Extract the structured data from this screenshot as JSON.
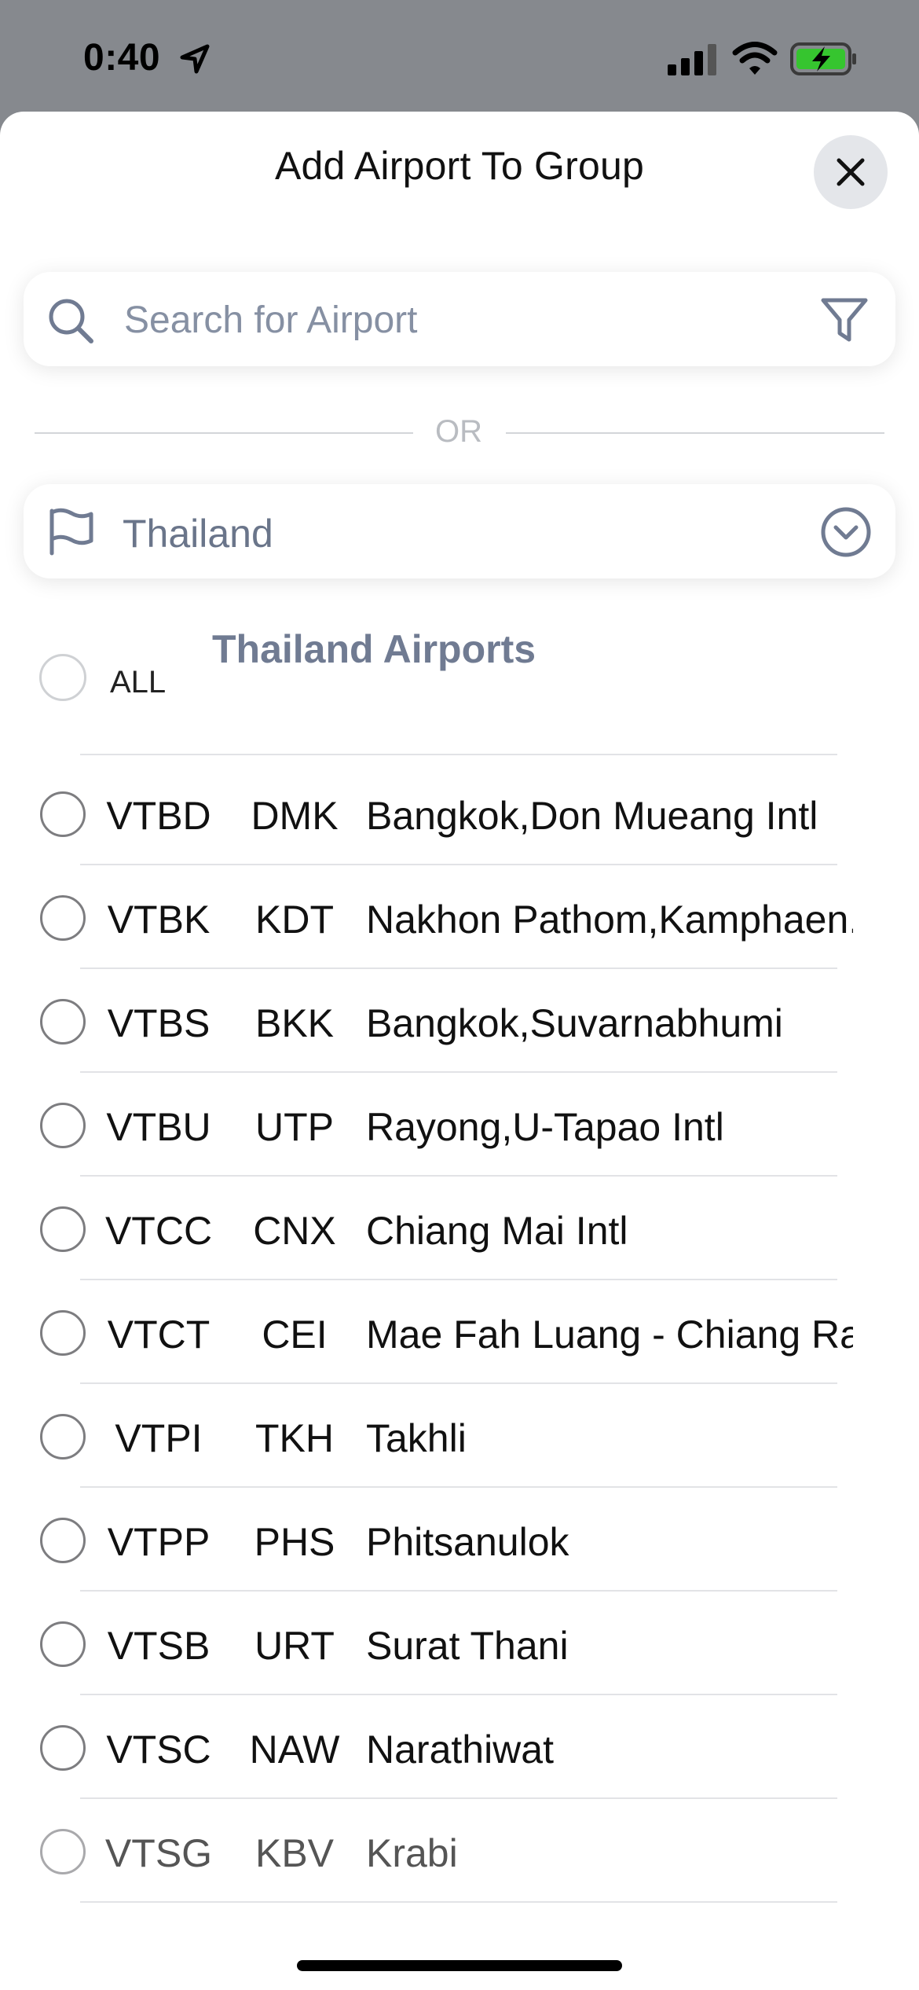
{
  "status_bar": {
    "time": "0:40"
  },
  "sheet": {
    "title": "Add Airport To Group"
  },
  "search": {
    "placeholder": "Search for Airport"
  },
  "separator_text": "OR",
  "country_select": {
    "value": "Thailand"
  },
  "select_all_label": "ALL",
  "section_title": "Thailand Airports",
  "airports": [
    {
      "icao": "VTBD",
      "iata": "DMK",
      "name": "Bangkok,Don Mueang Intl"
    },
    {
      "icao": "VTBK",
      "iata": "KDT",
      "name": "Nakhon Pathom,Kamphaen.."
    },
    {
      "icao": "VTBS",
      "iata": "BKK",
      "name": "Bangkok,Suvarnabhumi"
    },
    {
      "icao": "VTBU",
      "iata": "UTP",
      "name": "Rayong,U-Tapao Intl"
    },
    {
      "icao": "VTCC",
      "iata": "CNX",
      "name": "Chiang Mai Intl"
    },
    {
      "icao": "VTCT",
      "iata": "CEI",
      "name": "Mae Fah Luang - Chiang Ra.."
    },
    {
      "icao": "VTPI",
      "iata": "TKH",
      "name": "Takhli"
    },
    {
      "icao": "VTPP",
      "iata": "PHS",
      "name": "Phitsanulok"
    },
    {
      "icao": "VTSB",
      "iata": "URT",
      "name": "Surat Thani"
    },
    {
      "icao": "VTSC",
      "iata": "NAW",
      "name": "Narathiwat"
    },
    {
      "icao": "VTSG",
      "iata": "KBV",
      "name": "Krabi"
    }
  ],
  "icons": {
    "close": "close-icon",
    "search": "search-icon",
    "filter": "filter-icon",
    "flag": "flag-icon",
    "dropdown": "chevron-down-circle-icon"
  },
  "colors": {
    "accent_icon": "#707b92",
    "placeholder": "#8690a3",
    "battery_fill": "#36c52f"
  }
}
